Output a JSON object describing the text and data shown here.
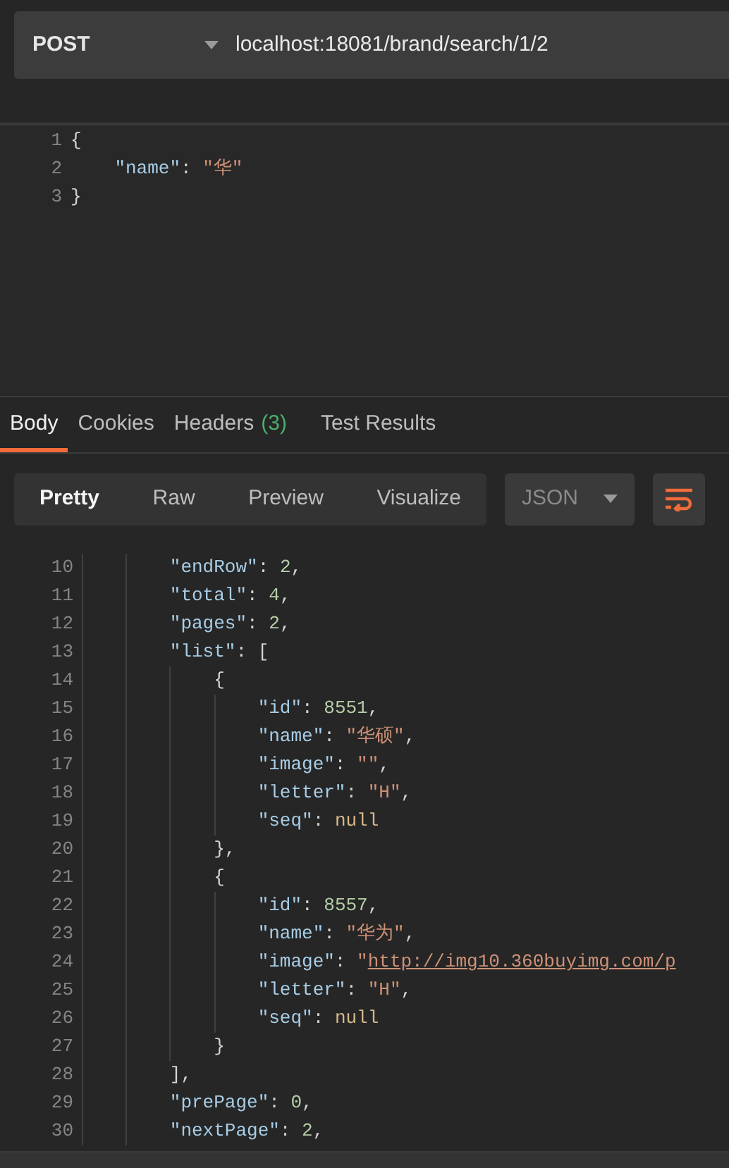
{
  "request": {
    "method": "POST",
    "url": "localhost:18081/brand/search/1/2",
    "body_lines": [
      {
        "number": "1",
        "tokens": [
          {
            "kind": "punct",
            "text": "{"
          }
        ],
        "children": [
          {
            "number": "2",
            "tokens": [
              {
                "kind": "key",
                "text": "\"name\""
              },
              {
                "kind": "punct",
                "text": ": "
              },
              {
                "kind": "string",
                "text": "\"华\""
              }
            ]
          }
        ]
      },
      {
        "number": "3",
        "tokens": [
          {
            "kind": "punct",
            "text": "}"
          }
        ]
      }
    ]
  },
  "response_tabs": [
    {
      "label": "Body",
      "selected": true
    },
    {
      "label": "Cookies",
      "selected": false
    },
    {
      "label": "Headers",
      "count": "(3)",
      "selected": false
    },
    {
      "label": "Test Results",
      "selected": false
    }
  ],
  "view_modes": [
    {
      "label": "Pretty",
      "selected": true
    },
    {
      "label": "Raw",
      "selected": false
    },
    {
      "label": "Preview",
      "selected": false
    },
    {
      "label": "Visualize",
      "selected": false
    }
  ],
  "format": "JSON",
  "response_lines": [
    {
      "number": "10",
      "tokens": [
        {
          "kind": "key",
          "text": "\"endRow\""
        },
        {
          "kind": "punct",
          "text": ": "
        },
        {
          "kind": "number",
          "text": "2"
        },
        {
          "kind": "punct",
          "text": ","
        }
      ]
    },
    {
      "number": "11",
      "tokens": [
        {
          "kind": "key",
          "text": "\"total\""
        },
        {
          "kind": "punct",
          "text": ": "
        },
        {
          "kind": "number",
          "text": "4"
        },
        {
          "kind": "punct",
          "text": ","
        }
      ]
    },
    {
      "number": "12",
      "tokens": [
        {
          "kind": "key",
          "text": "\"pages\""
        },
        {
          "kind": "punct",
          "text": ": "
        },
        {
          "kind": "number",
          "text": "2"
        },
        {
          "kind": "punct",
          "text": ","
        }
      ]
    },
    {
      "number": "13",
      "tokens": [
        {
          "kind": "key",
          "text": "\"list\""
        },
        {
          "kind": "punct",
          "text": ": ["
        }
      ],
      "children": [
        {
          "number": "14",
          "tokens": [
            {
              "kind": "punct",
              "text": "{"
            }
          ],
          "children": [
            {
              "number": "15",
              "tokens": [
                {
                  "kind": "key",
                  "text": "\"id\""
                },
                {
                  "kind": "punct",
                  "text": ": "
                },
                {
                  "kind": "number",
                  "text": "8551"
                },
                {
                  "kind": "punct",
                  "text": ","
                }
              ]
            },
            {
              "number": "16",
              "tokens": [
                {
                  "kind": "key",
                  "text": "\"name\""
                },
                {
                  "kind": "punct",
                  "text": ": "
                },
                {
                  "kind": "string",
                  "text": "\"华硕\""
                },
                {
                  "kind": "punct",
                  "text": ","
                }
              ]
            },
            {
              "number": "17",
              "tokens": [
                {
                  "kind": "key",
                  "text": "\"image\""
                },
                {
                  "kind": "punct",
                  "text": ": "
                },
                {
                  "kind": "string",
                  "text": "\"\""
                },
                {
                  "kind": "punct",
                  "text": ","
                }
              ]
            },
            {
              "number": "18",
              "tokens": [
                {
                  "kind": "key",
                  "text": "\"letter\""
                },
                {
                  "kind": "punct",
                  "text": ": "
                },
                {
                  "kind": "string",
                  "text": "\"H\""
                },
                {
                  "kind": "punct",
                  "text": ","
                }
              ]
            },
            {
              "number": "19",
              "tokens": [
                {
                  "kind": "key",
                  "text": "\"seq\""
                },
                {
                  "kind": "punct",
                  "text": ": "
                },
                {
                  "kind": "null",
                  "text": "null"
                }
              ]
            }
          ]
        },
        {
          "number": "20",
          "tokens": [
            {
              "kind": "punct",
              "text": "},"
            }
          ]
        },
        {
          "number": "21",
          "tokens": [
            {
              "kind": "punct",
              "text": "{"
            }
          ],
          "children": [
            {
              "number": "22",
              "tokens": [
                {
                  "kind": "key",
                  "text": "\"id\""
                },
                {
                  "kind": "punct",
                  "text": ": "
                },
                {
                  "kind": "number",
                  "text": "8557"
                },
                {
                  "kind": "punct",
                  "text": ","
                }
              ]
            },
            {
              "number": "23",
              "tokens": [
                {
                  "kind": "key",
                  "text": "\"name\""
                },
                {
                  "kind": "punct",
                  "text": ": "
                },
                {
                  "kind": "string",
                  "text": "\"华为\""
                },
                {
                  "kind": "punct",
                  "text": ","
                }
              ]
            },
            {
              "number": "24",
              "tokens": [
                {
                  "kind": "key",
                  "text": "\"image\""
                },
                {
                  "kind": "punct",
                  "text": ": "
                },
                {
                  "kind": "string",
                  "text": "\""
                },
                {
                  "kind": "link",
                  "text": "http://img10.360buyimg.com/p"
                }
              ]
            },
            {
              "number": "25",
              "tokens": [
                {
                  "kind": "key",
                  "text": "\"letter\""
                },
                {
                  "kind": "punct",
                  "text": ": "
                },
                {
                  "kind": "string",
                  "text": "\"H\""
                },
                {
                  "kind": "punct",
                  "text": ","
                }
              ]
            },
            {
              "number": "26",
              "tokens": [
                {
                  "kind": "key",
                  "text": "\"seq\""
                },
                {
                  "kind": "punct",
                  "text": ": "
                },
                {
                  "kind": "null",
                  "text": "null"
                }
              ]
            }
          ]
        },
        {
          "number": "27",
          "tokens": [
            {
              "kind": "punct",
              "text": "}"
            }
          ]
        }
      ]
    },
    {
      "number": "28",
      "tokens": [
        {
          "kind": "punct",
          "text": "],"
        }
      ]
    },
    {
      "number": "29",
      "tokens": [
        {
          "kind": "key",
          "text": "\"prePage\""
        },
        {
          "kind": "punct",
          "text": ": "
        },
        {
          "kind": "number",
          "text": "0"
        },
        {
          "kind": "punct",
          "text": ","
        }
      ]
    },
    {
      "number": "30",
      "tokens": [
        {
          "kind": "key",
          "text": "\"nextPage\""
        },
        {
          "kind": "punct",
          "text": ": "
        },
        {
          "kind": "number",
          "text": "2"
        },
        {
          "kind": "punct",
          "text": ","
        }
      ]
    }
  ]
}
